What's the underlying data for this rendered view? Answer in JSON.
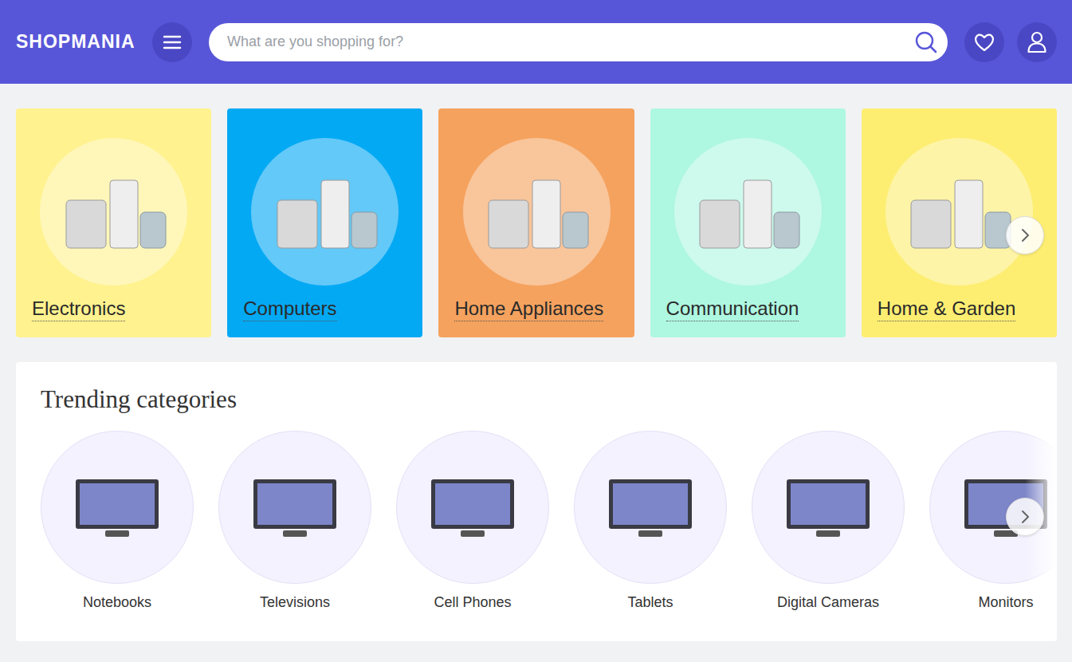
{
  "header": {
    "logo": "SHOPMANIA"
  },
  "search": {
    "placeholder": "What are you shopping for?"
  },
  "categories": [
    {
      "label": "Electronics",
      "color": "#fff28f"
    },
    {
      "label": "Computers",
      "color": "#04a9f4"
    },
    {
      "label": "Home Appliances",
      "color": "#f5a25e"
    },
    {
      "label": "Communication",
      "color": "#aef7e0"
    },
    {
      "label": "Home & Garden",
      "color": "#fdee72"
    }
  ],
  "trending": {
    "title": "Trending categories",
    "items": [
      {
        "label": "Notebooks"
      },
      {
        "label": "Televisions"
      },
      {
        "label": "Cell Phones"
      },
      {
        "label": "Tablets"
      },
      {
        "label": "Digital Cameras"
      },
      {
        "label": "Monitors"
      }
    ]
  }
}
